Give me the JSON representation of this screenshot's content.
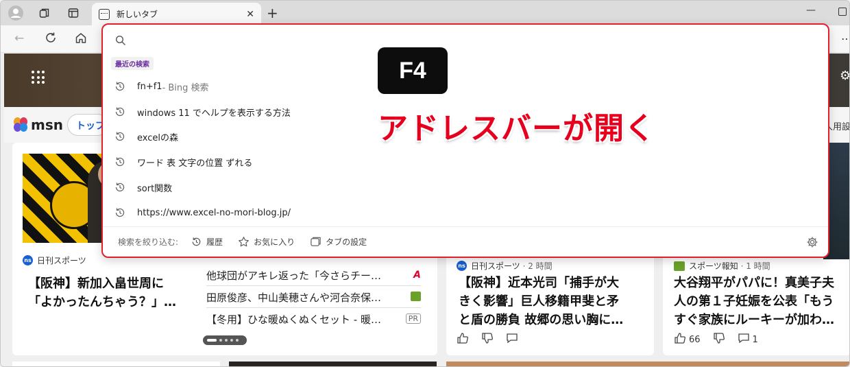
{
  "browser": {
    "tab_title": "新しいタブ",
    "new_tab_symbol": "+"
  },
  "omnibox": {
    "recent_label": "最近の検索",
    "suggestions": [
      {
        "text": "fn+f1",
        "suffix": " - Bing 検索"
      },
      {
        "text": "windows 11 でヘルプを表示する方法",
        "suffix": ""
      },
      {
        "text": "excelの森",
        "suffix": ""
      },
      {
        "text": "ワード 表 文字の位置 ずれる",
        "suffix": ""
      },
      {
        "text": "sort関数",
        "suffix": ""
      },
      {
        "text": "https://www.excel-no-mori-blog.jp/",
        "suffix": ""
      }
    ],
    "footer": {
      "narrow_label": "検索を絞り込む:",
      "history": "履歴",
      "favorites": "お気に入り",
      "tab_settings": "タブの設定"
    }
  },
  "annotation": {
    "key": "F4",
    "caption": "アドレスバーが開く"
  },
  "msn": {
    "logo_text": "msn",
    "top_pill": "トップ",
    "settings_partial": "人用設"
  },
  "cards": {
    "card1": {
      "source": "日刊スポーツ",
      "headline_line1": "【阪神】新加入畠世周に",
      "headline_line2": "「よかったんちゃう？」…"
    },
    "list": [
      "他球団がアキレ返った「今さらチー…",
      "田原俊彦、中山美穂さんや河合奈保…",
      "【冬用】ひな暖ぬくぬくセット - 暖…"
    ],
    "pr_badge": "PR",
    "card2": {
      "source": "日刊スポーツ",
      "time": "· 2 時間",
      "headline_line1": "【阪神】近本光司「捕手が大",
      "headline_line2": "きく影響」巨人移籍甲斐と矛",
      "headline_line3": "と盾の勝負 故郷の思い胸に…"
    },
    "card3": {
      "source": "スポーツ報知",
      "time": "· 1 時間",
      "headline_line1": "大谷翔平がパパに！真美子夫",
      "headline_line2": "人の第１子妊娠を公表「もう",
      "headline_line3": "すぐ家族にルーキーが加わ…",
      "likes": "66",
      "comments": "1"
    }
  },
  "colors": {
    "accent_red": "#e6001e",
    "frame_red": "#e0202c",
    "recent_purple": "#6a2c9e",
    "msn_blue": "#1a5fd0"
  }
}
